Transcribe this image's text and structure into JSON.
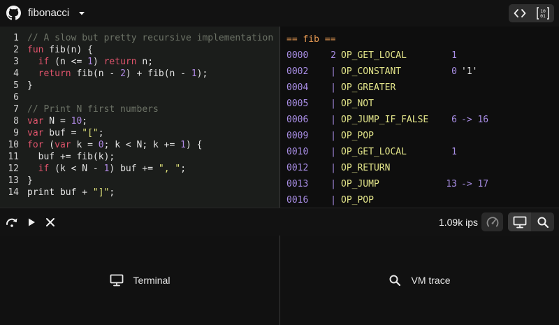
{
  "header": {
    "project_name": "fibonacci",
    "icons": {
      "logo": "github-icon",
      "menu": "chevron-down-icon",
      "code_view": "code-icon",
      "binary_view": "binary-icon"
    }
  },
  "editor": {
    "lines": [
      {
        "n": "1",
        "tokens": [
          {
            "c": "comment",
            "t": "// A slow but pretty recursive implementation"
          }
        ]
      },
      {
        "n": "2",
        "tokens": [
          {
            "c": "kw",
            "t": "fun"
          },
          {
            "c": "id",
            "t": " fib(n) {"
          }
        ]
      },
      {
        "n": "3",
        "tokens": [
          {
            "c": "id",
            "t": "  "
          },
          {
            "c": "kw",
            "t": "if"
          },
          {
            "c": "id",
            "t": " (n <= "
          },
          {
            "c": "num",
            "t": "1"
          },
          {
            "c": "id",
            "t": ") "
          },
          {
            "c": "kw",
            "t": "return"
          },
          {
            "c": "id",
            "t": " n;"
          }
        ]
      },
      {
        "n": "4",
        "tokens": [
          {
            "c": "id",
            "t": "  "
          },
          {
            "c": "kw",
            "t": "return"
          },
          {
            "c": "id",
            "t": " fib(n - "
          },
          {
            "c": "num",
            "t": "2"
          },
          {
            "c": "id",
            "t": ") + fib(n - "
          },
          {
            "c": "num",
            "t": "1"
          },
          {
            "c": "id",
            "t": ");"
          }
        ]
      },
      {
        "n": "5",
        "tokens": [
          {
            "c": "id",
            "t": "}"
          }
        ]
      },
      {
        "n": "6",
        "tokens": []
      },
      {
        "n": "7",
        "tokens": [
          {
            "c": "comment",
            "t": "// Print N first numbers"
          }
        ]
      },
      {
        "n": "8",
        "tokens": [
          {
            "c": "kw",
            "t": "var"
          },
          {
            "c": "id",
            "t": " N = "
          },
          {
            "c": "num",
            "t": "10"
          },
          {
            "c": "id",
            "t": ";"
          }
        ]
      },
      {
        "n": "9",
        "tokens": [
          {
            "c": "kw",
            "t": "var"
          },
          {
            "c": "id",
            "t": " buf = "
          },
          {
            "c": "str",
            "t": "\"[\""
          },
          {
            "c": "id",
            "t": ";"
          }
        ]
      },
      {
        "n": "10",
        "tokens": [
          {
            "c": "kw",
            "t": "for"
          },
          {
            "c": "id",
            "t": " ("
          },
          {
            "c": "kw",
            "t": "var"
          },
          {
            "c": "id",
            "t": " k = "
          },
          {
            "c": "num",
            "t": "0"
          },
          {
            "c": "id",
            "t": "; k < N; k += "
          },
          {
            "c": "num",
            "t": "1"
          },
          {
            "c": "id",
            "t": ") {"
          }
        ]
      },
      {
        "n": "11",
        "tokens": [
          {
            "c": "id",
            "t": "  buf += fib(k);"
          }
        ]
      },
      {
        "n": "12",
        "tokens": [
          {
            "c": "id",
            "t": "  "
          },
          {
            "c": "kw",
            "t": "if"
          },
          {
            "c": "id",
            "t": " (k < N - "
          },
          {
            "c": "num",
            "t": "1"
          },
          {
            "c": "id",
            "t": ") buf += "
          },
          {
            "c": "str",
            "t": "\", \""
          },
          {
            "c": "id",
            "t": ";"
          }
        ]
      },
      {
        "n": "13",
        "tokens": [
          {
            "c": "id",
            "t": "}"
          }
        ]
      },
      {
        "n": "14",
        "tokens": [
          {
            "c": "id",
            "t": "print buf + "
          },
          {
            "c": "str",
            "t": "\"]\""
          },
          {
            "c": "id",
            "t": ";"
          }
        ]
      }
    ]
  },
  "bytecode": {
    "header": "== fib ==",
    "rows": [
      {
        "offset": "0000",
        "line": "2",
        "op": "OP_GET_LOCAL",
        "arg": "1",
        "extra": ""
      },
      {
        "offset": "0002",
        "line": "|",
        "op": "OP_CONSTANT",
        "arg": "0",
        "extra": "'1'"
      },
      {
        "offset": "0004",
        "line": "|",
        "op": "OP_GREATER",
        "arg": "",
        "extra": ""
      },
      {
        "offset": "0005",
        "line": "|",
        "op": "OP_NOT",
        "arg": "",
        "extra": ""
      },
      {
        "offset": "0006",
        "line": "|",
        "op": "OP_JUMP_IF_FALSE",
        "arg": "6",
        "extra": "-> 16"
      },
      {
        "offset": "0009",
        "line": "|",
        "op": "OP_POP",
        "arg": "",
        "extra": ""
      },
      {
        "offset": "0010",
        "line": "|",
        "op": "OP_GET_LOCAL",
        "arg": "1",
        "extra": ""
      },
      {
        "offset": "0012",
        "line": "|",
        "op": "OP_RETURN",
        "arg": "",
        "extra": ""
      },
      {
        "offset": "0013",
        "line": "|",
        "op": "OP_JUMP",
        "arg": "13",
        "extra": "-> 17"
      },
      {
        "offset": "0016",
        "line": "|",
        "op": "OP_POP",
        "arg": "",
        "extra": ""
      }
    ]
  },
  "toolbar": {
    "ips": "1.09k ips",
    "icons": {
      "step": "step-over-icon",
      "run": "play-icon",
      "stop": "close-icon",
      "speed": "speedometer-icon",
      "terminal": "monitor-icon",
      "trace": "search-icon"
    }
  },
  "panes": {
    "terminal_label": "Terminal",
    "trace_label": "VM trace"
  },
  "colors": {
    "comment": "#6d7367",
    "keyword": "#e0546c",
    "number": "#b18ae6",
    "string": "#dfe17a",
    "opcode": "#e3e58a",
    "offset": "#a98ee6",
    "bc_header": "#e89a52"
  }
}
